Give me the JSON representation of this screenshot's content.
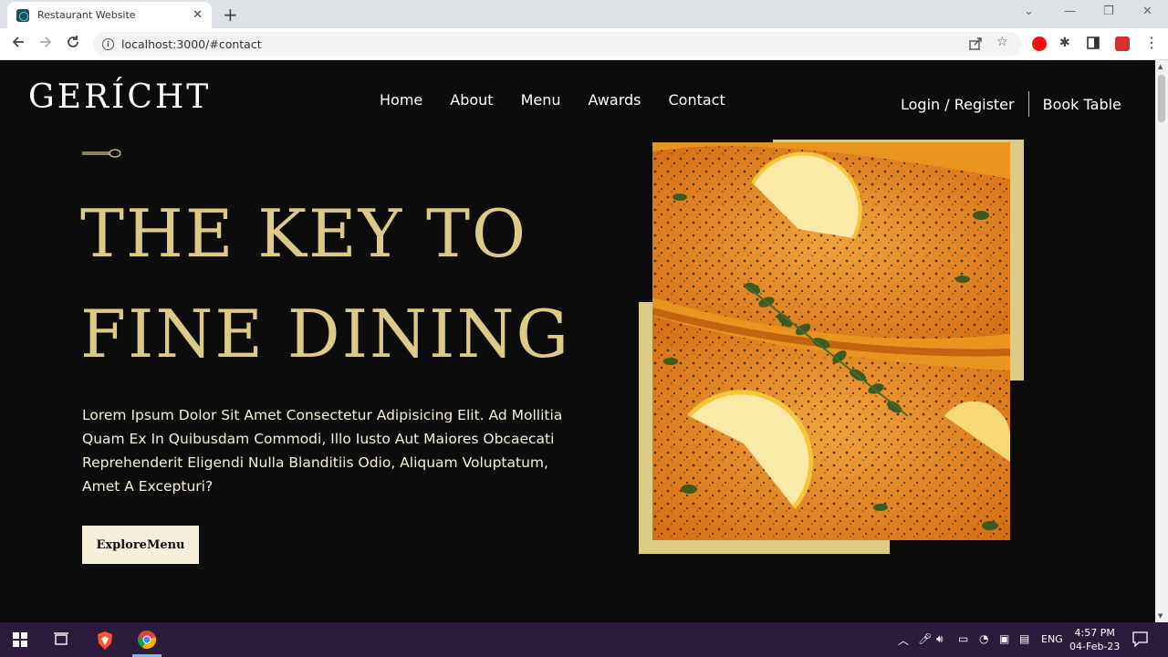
{
  "browser": {
    "tab_title": "Restaurant Website",
    "tab_close": "✕",
    "new_tab": "+",
    "url": "localhost:3000/#contact",
    "window_controls": [
      "⌄",
      "—",
      "❐",
      "✕"
    ]
  },
  "site": {
    "logo": "GERÍCHT",
    "nav": [
      "Home",
      "About",
      "Menu",
      "Awards",
      "Contact"
    ],
    "login_register": "Login / Register",
    "book_table": "Book Table"
  },
  "hero": {
    "headline_line1": "THE KEY TO",
    "headline_line2": "FINE DINING",
    "description": "Lorem Ipsum Dolor Sit Amet Consectetur Adipisicing Elit. Ad Mollitia Quam Ex In Quibusdam Commodi, Illo Iusto Aut Maiores Obcaecati Reprehenderit Eligendi Nulla Blanditiis Odio, Aliquam Voluptatum, Amet A Excepturi?",
    "button_label": "ExploreMenu"
  },
  "taskbar": {
    "language": "ENG",
    "time": "4:57 PM",
    "date": "04-Feb-23"
  },
  "colors": {
    "gold": "#dcca87",
    "dark": "#0c0c0c",
    "cream": "#f5efdb",
    "taskbar": "#2b1b3d"
  }
}
